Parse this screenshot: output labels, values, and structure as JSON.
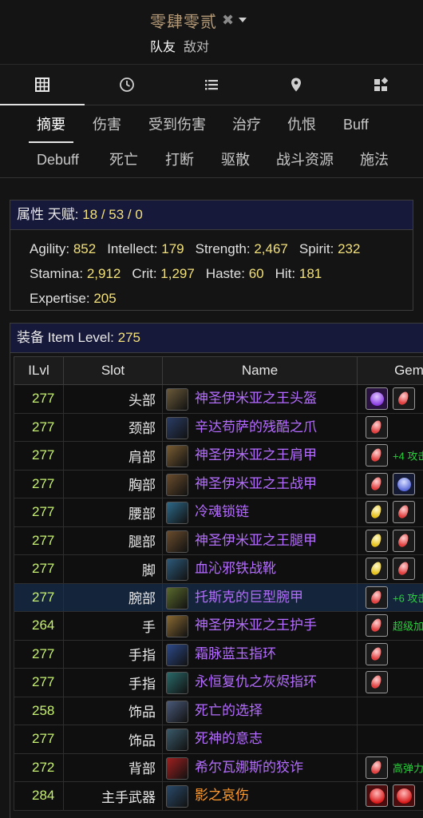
{
  "header": {
    "player_name": "零肆零贰",
    "side_friend": "队友",
    "side_enemy": "敌对"
  },
  "icon_tabs": [
    {
      "icon": "grid-icon",
      "active": true
    },
    {
      "icon": "clock-icon",
      "active": false
    },
    {
      "icon": "list-icon",
      "active": false
    },
    {
      "icon": "map-pin-icon",
      "active": false
    },
    {
      "icon": "widgets-icon",
      "active": false
    }
  ],
  "tabs": [
    "摘要",
    "伤害",
    "受到伤害",
    "治疗",
    "仇恨",
    "Buff",
    "Debuff",
    "死亡",
    "打断",
    "驱散",
    "战斗资源",
    "施法"
  ],
  "attributes": {
    "title": "属性 天赋:",
    "talents": "18 / 53 / 0",
    "stats": [
      {
        "label": "Agility:",
        "value": "852"
      },
      {
        "label": "Intellect:",
        "value": "179"
      },
      {
        "label": "Strength:",
        "value": "2,467"
      },
      {
        "label": "Spirit:",
        "value": "232"
      },
      {
        "label": "Stamina:",
        "value": "2,912"
      },
      {
        "label": "Crit:",
        "value": "1,297"
      },
      {
        "label": "Haste:",
        "value": "60"
      },
      {
        "label": "Hit:",
        "value": "181"
      },
      {
        "label": "Expertise:",
        "value": "205"
      }
    ]
  },
  "gear": {
    "title": "装备 Item Level:",
    "item_level": "275",
    "columns": [
      "ILvl",
      "Slot",
      "Name",
      "Gem"
    ],
    "rows": [
      {
        "ilvl": "277",
        "slot": "头部",
        "name": "神圣伊米亚之王头盔",
        "gems": [
          "purple",
          "red"
        ],
        "bonus": ""
      },
      {
        "ilvl": "277",
        "slot": "颈部",
        "name": "辛达苟萨的残酷之爪",
        "gems": [
          "red"
        ],
        "bonus": ""
      },
      {
        "ilvl": "277",
        "slot": "肩部",
        "name": "神圣伊米亚之王肩甲",
        "gems": [
          "red"
        ],
        "bonus": "+4 攻击"
      },
      {
        "ilvl": "277",
        "slot": "胸部",
        "name": "神圣伊米亚之王战甲",
        "gems": [
          "red",
          "blue"
        ],
        "bonus": ""
      },
      {
        "ilvl": "277",
        "slot": "腰部",
        "name": "冷魂锁链",
        "gems": [
          "yellow",
          "red"
        ],
        "bonus": ""
      },
      {
        "ilvl": "277",
        "slot": "腿部",
        "name": "神圣伊米亚之王腿甲",
        "gems": [
          "yellow",
          "red"
        ],
        "bonus": ""
      },
      {
        "ilvl": "277",
        "slot": "脚",
        "name": "血沁邪铁战靴",
        "gems": [
          "yellow",
          "red"
        ],
        "bonus": ""
      },
      {
        "ilvl": "277",
        "slot": "腕部",
        "name": "托斯克的巨型腕甲",
        "gems": [
          "red"
        ],
        "bonus": "+6 攻击"
      },
      {
        "ilvl": "264",
        "slot": "手",
        "name": "神圣伊米亚之王护手",
        "gems": [
          "red"
        ],
        "bonus": "超级加"
      },
      {
        "ilvl": "277",
        "slot": "手指",
        "name": "霜脉蓝玉指环",
        "gems": [
          "red"
        ],
        "bonus": ""
      },
      {
        "ilvl": "277",
        "slot": "手指",
        "name": "永恒复仇之灰烬指环",
        "gems": [
          "red"
        ],
        "bonus": ""
      },
      {
        "ilvl": "258",
        "slot": "饰品",
        "name": "死亡的选择",
        "gems": [],
        "bonus": ""
      },
      {
        "ilvl": "277",
        "slot": "饰品",
        "name": "死神的意志",
        "gems": [],
        "bonus": ""
      },
      {
        "ilvl": "272",
        "slot": "背部",
        "name": "希尔瓦娜斯的狡诈",
        "gems": [
          "red"
        ],
        "bonus": "高弹力"
      },
      {
        "ilvl": "284",
        "slot": "主手武器",
        "name": "影之哀伤",
        "gems": [
          "ruby",
          "ruby"
        ],
        "bonus": "",
        "legendary": true
      }
    ],
    "highlight_row": 7
  },
  "colors": {
    "item_epic": "#b46cff",
    "item_legendary": "#ff9a2e",
    "ilvl": "#c6f070",
    "stat_value": "#f2e07a",
    "section_header_bg": "#17193a",
    "gem_bonus": "#27d13a"
  }
}
